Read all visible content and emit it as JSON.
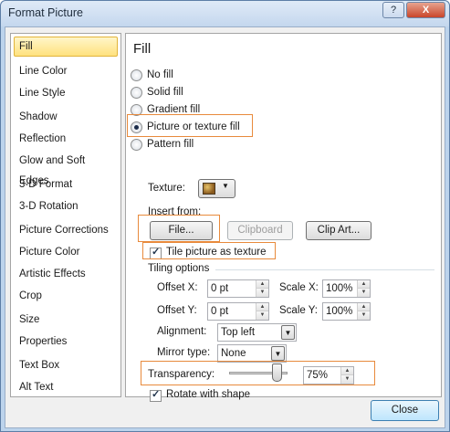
{
  "window": {
    "title": "Format Picture",
    "help_label": "?",
    "close_label": "X"
  },
  "sidebar": {
    "items": [
      {
        "label": "Fill",
        "selected": true
      },
      {
        "label": "Line Color"
      },
      {
        "label": "Line Style"
      },
      {
        "label": "Shadow"
      },
      {
        "label": "Reflection"
      },
      {
        "label": "Glow and Soft Edges"
      },
      {
        "label": "3-D Format"
      },
      {
        "label": "3-D Rotation"
      },
      {
        "label": "Picture Corrections"
      },
      {
        "label": "Picture Color"
      },
      {
        "label": "Artistic Effects"
      },
      {
        "label": "Crop"
      },
      {
        "label": "Size"
      },
      {
        "label": "Properties"
      },
      {
        "label": "Text Box"
      },
      {
        "label": "Alt Text"
      }
    ]
  },
  "fill": {
    "heading": "Fill",
    "options": [
      {
        "label": "No fill",
        "checked": false
      },
      {
        "label": "Solid fill",
        "checked": false
      },
      {
        "label": "Gradient fill",
        "checked": false
      },
      {
        "label": "Picture or texture fill",
        "checked": true
      },
      {
        "label": "Pattern fill",
        "checked": false
      }
    ],
    "texture_label": "Texture:",
    "insert_from_label": "Insert from:",
    "file_button": "File...",
    "clipboard_button": "Clipboard",
    "clipart_button": "Clip Art...",
    "tile_checkbox": {
      "label": "Tile picture as texture",
      "checked": true
    },
    "tiling_options_label": "Tiling options",
    "offset_x": {
      "label": "Offset X:",
      "value": "0 pt"
    },
    "offset_y": {
      "label": "Offset Y:",
      "value": "0 pt"
    },
    "scale_x": {
      "label": "Scale X:",
      "value": "100%"
    },
    "scale_y": {
      "label": "Scale Y:",
      "value": "100%"
    },
    "alignment": {
      "label": "Alignment:",
      "value": "Top left"
    },
    "mirror_type": {
      "label": "Mirror type:",
      "value": "None"
    },
    "transparency": {
      "label": "Transparency:",
      "value": "75%",
      "level": 0.75
    },
    "rotate_checkbox": {
      "label": "Rotate with shape",
      "checked": true
    }
  },
  "footer": {
    "close_button": "Close"
  },
  "colors": {
    "highlight": "#e88a3c",
    "selected_item": "#ffe27e",
    "title_bar": "#c4d7ee"
  }
}
